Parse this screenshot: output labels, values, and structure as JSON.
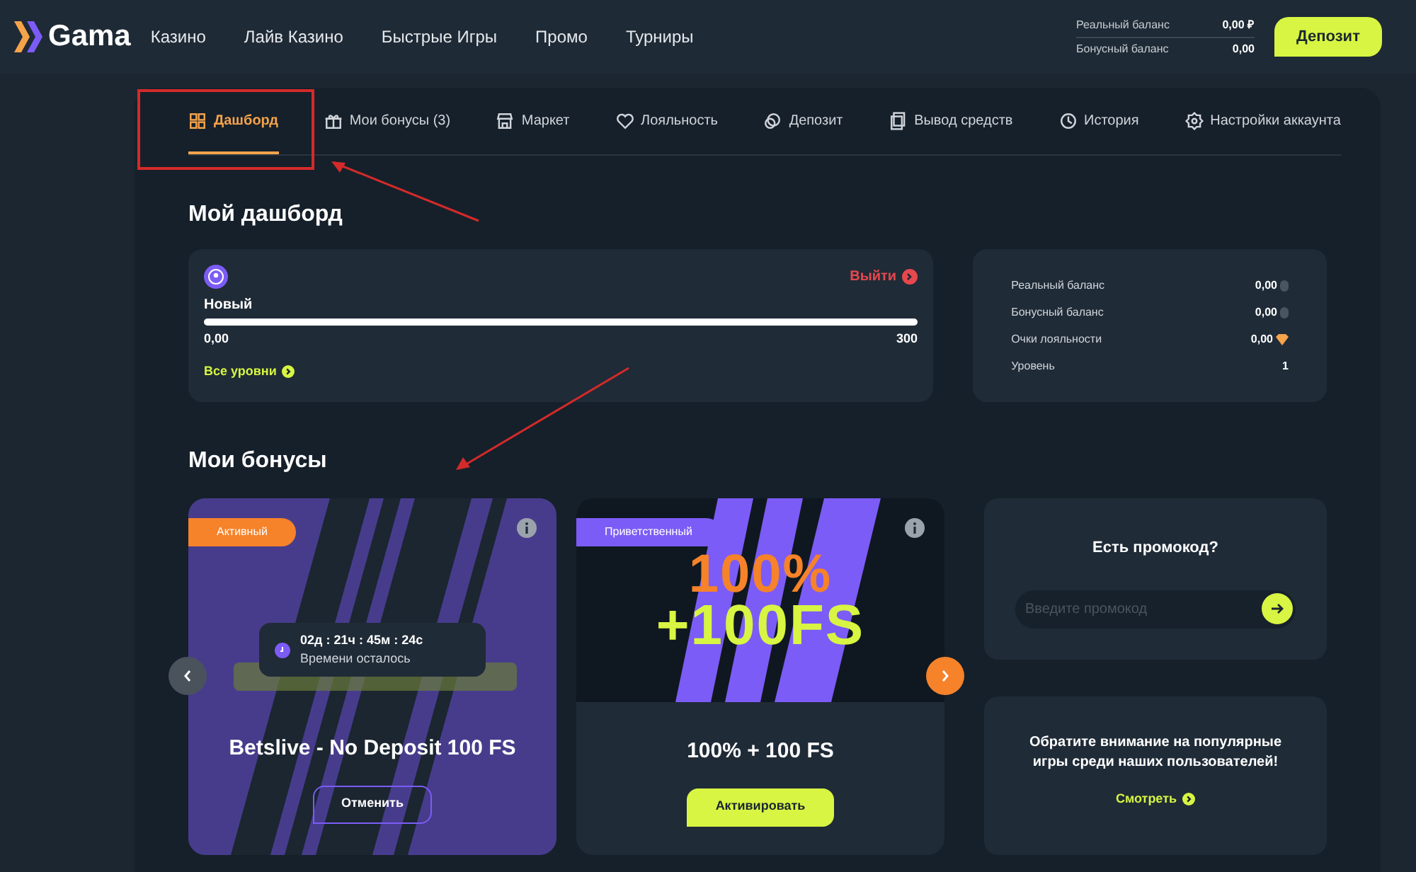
{
  "header": {
    "logo": "Gama",
    "nav": [
      {
        "label": "Казино"
      },
      {
        "label": "Лайв Казино"
      },
      {
        "label": "Быстрые Игры"
      },
      {
        "label": "Промо"
      },
      {
        "label": "Турниры"
      }
    ],
    "balances": [
      {
        "label": "Реальный баланс",
        "value": "0,00 ₽"
      },
      {
        "label": "Бонусный баланс",
        "value": "0,00"
      }
    ],
    "deposit_button": "Депозит"
  },
  "tabs": [
    {
      "label": "Дашборд",
      "selected": true
    },
    {
      "label": "Мои бонусы (3)",
      "selected": false
    },
    {
      "label": "Маркет",
      "selected": false
    },
    {
      "label": "Лояльность",
      "selected": false
    },
    {
      "label": "Депозит",
      "selected": false
    },
    {
      "label": "Вывод средств",
      "selected": false
    },
    {
      "label": "История",
      "selected": false
    },
    {
      "label": "Настройки аккаунта",
      "selected": false
    }
  ],
  "dashboard": {
    "title": "Мой дашборд",
    "logout": "Выйти",
    "level_name": "Новый",
    "progress": {
      "min": "0,00",
      "max": "300"
    },
    "all_levels": "Все уровни",
    "stats": [
      {
        "label": "Реальный баланс",
        "value": "0,00"
      },
      {
        "label": "Бонусный баланс",
        "value": "0,00"
      },
      {
        "label": "Очки лояльности",
        "value": "0,00"
      },
      {
        "label": "Уровень",
        "value": "1"
      }
    ]
  },
  "bonuses": {
    "title": "Мои бонусы",
    "cards": [
      {
        "kind": "active",
        "tag": "Активный",
        "timer": "02д : 21ч : 45м : 24с",
        "timer_label": "Времени осталось",
        "name": "Betslive - No Deposit 100 FS",
        "button": "Отменить"
      },
      {
        "kind": "welcome",
        "tag": "Приветственный",
        "banner_lines": [
          "100%",
          "+100FS"
        ],
        "name": "100% + 100 FS",
        "button": "Активировать"
      }
    ],
    "promo": {
      "title": "Есть промокод?",
      "placeholder": "Введите промокод"
    },
    "popular": {
      "text": "Обратите внимание на популярные игры среди наших пользователей!",
      "link": "Смотреть"
    }
  }
}
